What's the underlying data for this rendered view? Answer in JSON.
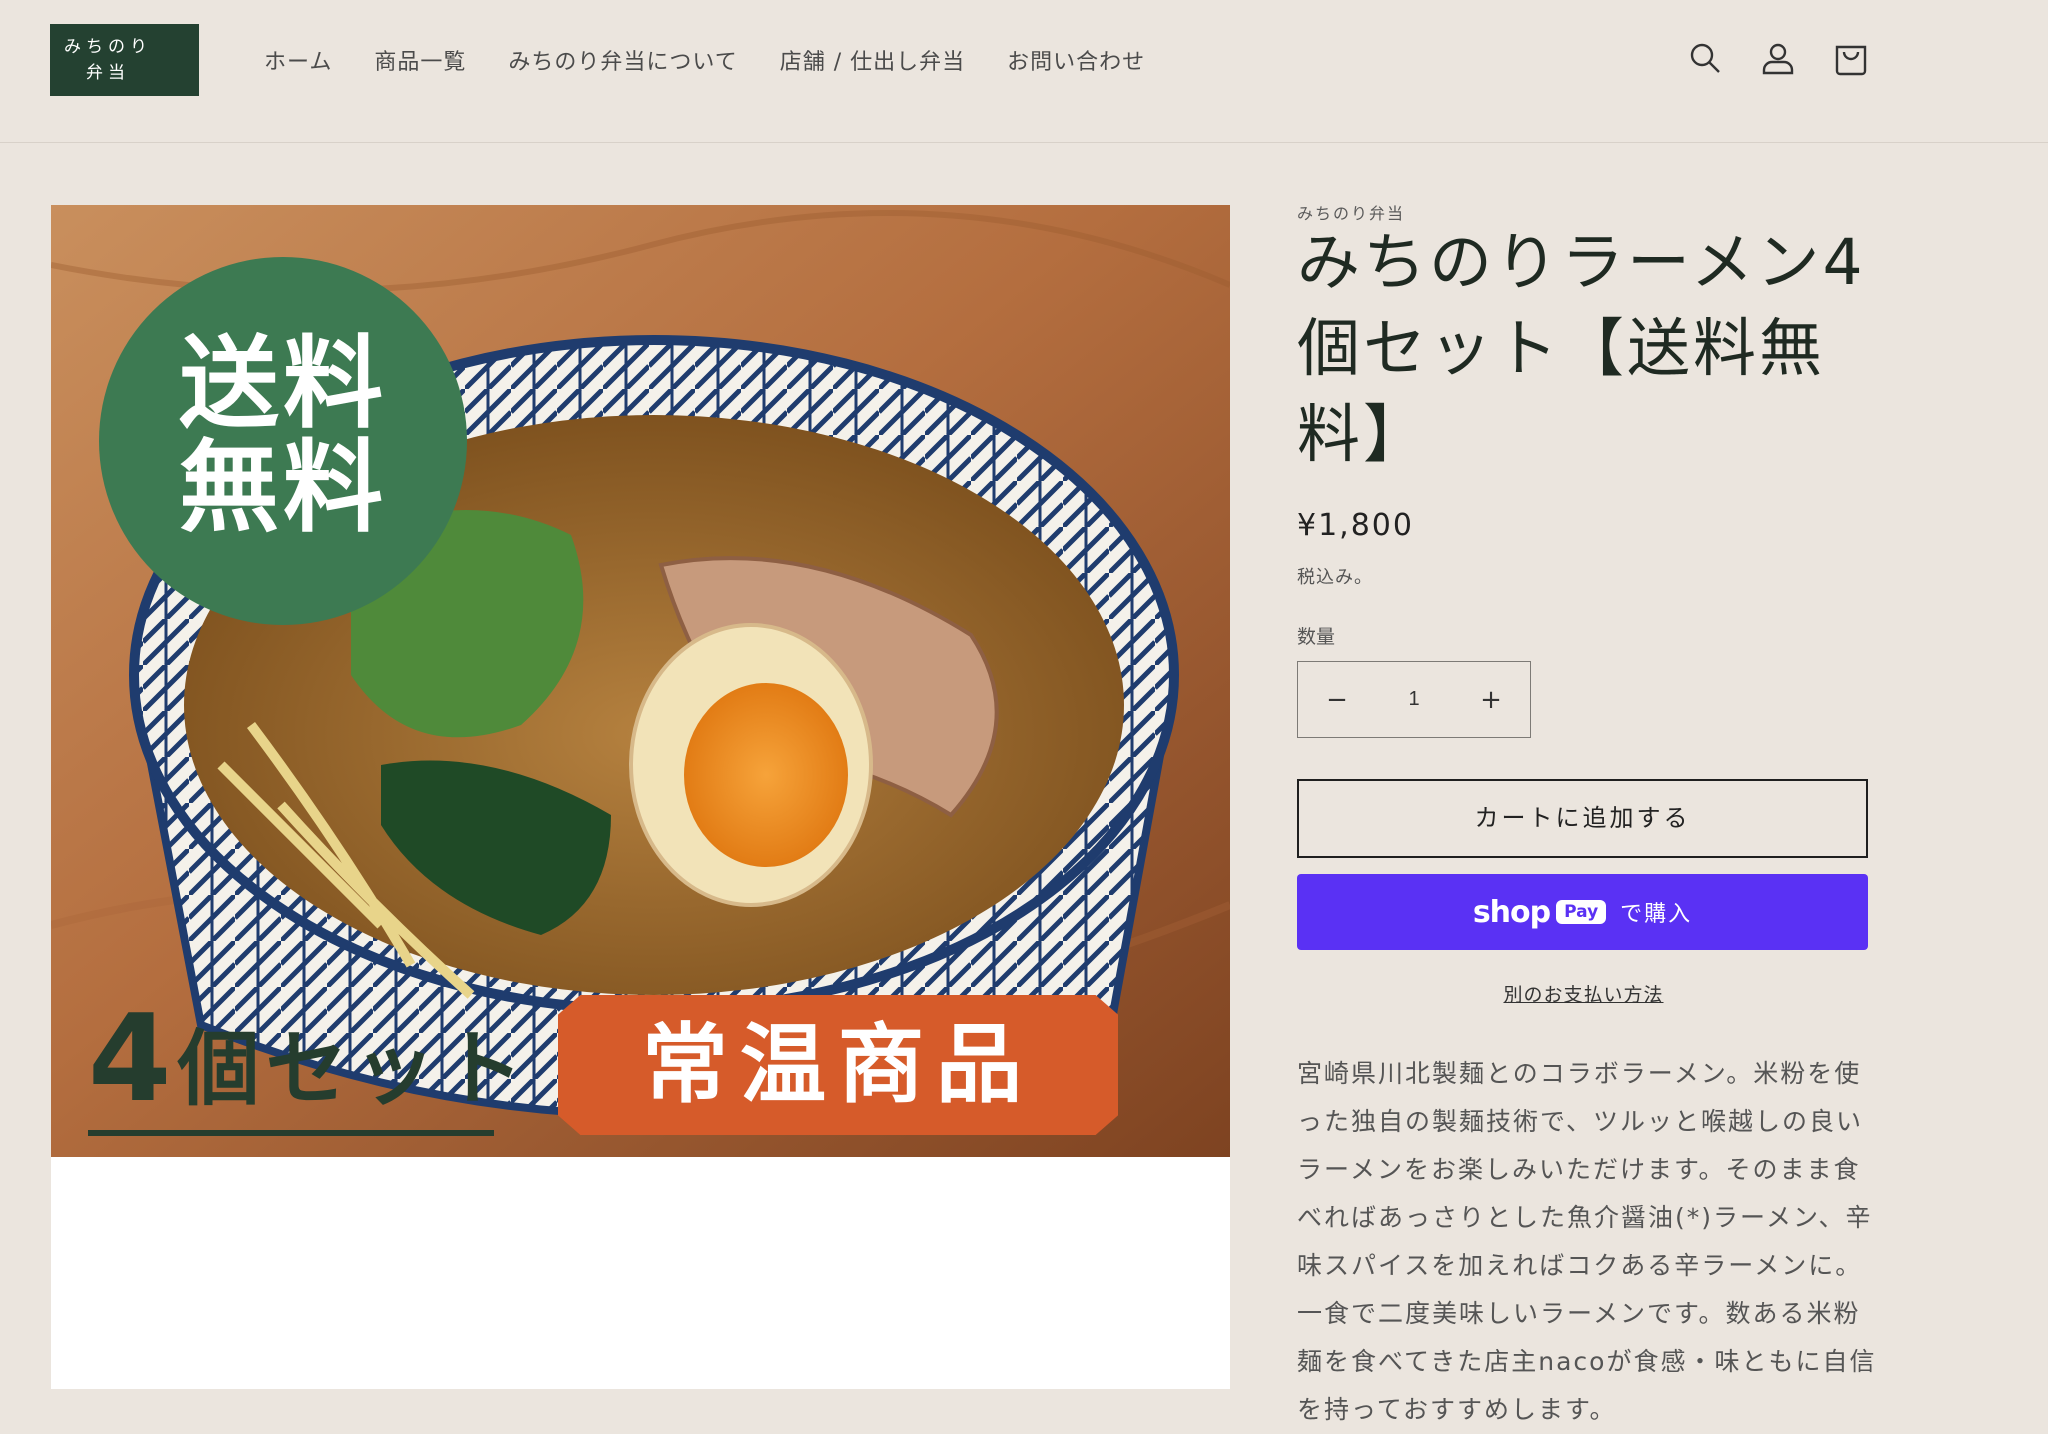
{
  "header": {
    "logo_line1": "みちのり",
    "logo_line2": "弁当",
    "nav": [
      "ホーム",
      "商品一覧",
      "みちのり弁当について",
      "店舗 / 仕出し弁当",
      "お問い合わせ"
    ]
  },
  "media": {
    "badge_free_shipping_line1": "送料",
    "badge_free_shipping_line2": "無料",
    "set_count": "4",
    "set_text": "個セット",
    "storage_badge": "常温商品"
  },
  "product": {
    "vendor": "みちのり弁当",
    "title": "みちのりラーメン4個セット【送料無料】",
    "price": "¥1,800",
    "tax_note": "税込み。",
    "quantity_label": "数量",
    "quantity_value": "1",
    "add_to_cart": "カートに追加する",
    "shop_pay_word": "shop",
    "shop_pay_pay": "Pay",
    "shop_pay_buy": "で購入",
    "more_payment": "別のお支払い方法",
    "description": "宮崎県川北製麺とのコラボラーメン。米粉を使った独自の製麺技術で、ツルッと喉越しの良いラーメンをお楽しみいただけます。そのまま食べればあっさりとした魚介醤油(*)ラーメン、辛味スパイスを加えればコクある辛ラーメンに。一食で二度美味しいラーメンです。数ある米粉麺を食べてきた店主nacoが食感・味ともに自信を持っておすすめします。"
  },
  "colors": {
    "background": "#ebe5de",
    "logo_bg": "#244131",
    "badge_green": "#3d7a52",
    "badge_orange": "#d65b2a",
    "shop_pay": "#5a31f4"
  }
}
